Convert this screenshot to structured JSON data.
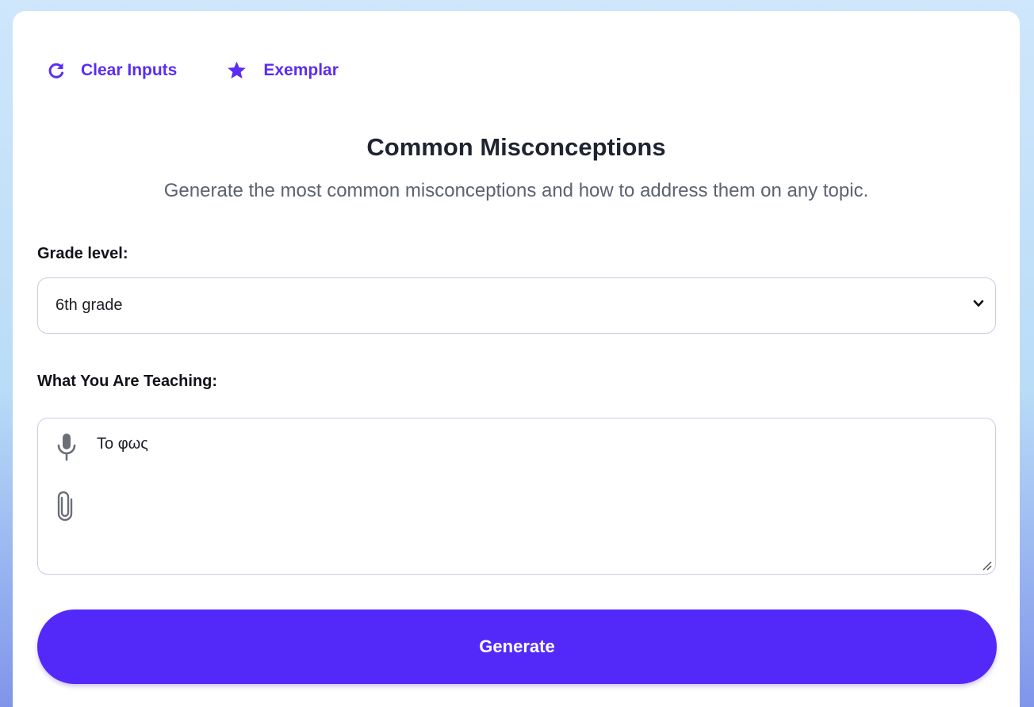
{
  "toolbar": {
    "clear_label": "Clear Inputs",
    "exemplar_label": "Exemplar"
  },
  "header": {
    "title": "Common Misconceptions",
    "subtitle": "Generate the most common misconceptions and how to address them on any topic."
  },
  "form": {
    "grade_label": "Grade level:",
    "grade_value": "6th grade",
    "teaching_label": "What You Are Teaching:",
    "teaching_value": "Το φως"
  },
  "actions": {
    "generate_label": "Generate"
  },
  "icons": {
    "clear": "refresh-icon",
    "exemplar": "star-icon",
    "select": "chevron-down-icon",
    "mic": "microphone-icon",
    "attach": "paperclip-icon",
    "resize": "resize-handle-icon"
  },
  "colors": {
    "accent": "#5329fa",
    "link": "#5a2cf5",
    "border": "#c7cde6"
  }
}
